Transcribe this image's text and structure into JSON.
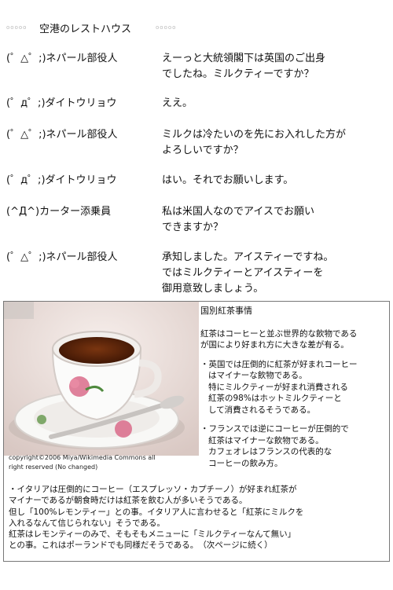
{
  "title": "空港のレストハウス",
  "title_deco": "ooooo",
  "dialogue": [
    {
      "speaker": "(゜△゜;)ネパール部役人",
      "lines": [
        "えーっと大統領閣下は英国のご出身",
        "でしたね。ミルクティーですか？"
      ]
    },
    {
      "speaker": "(゜д゜;)ダイトウリョウ",
      "lines": [
        "ええ。"
      ]
    },
    {
      "speaker": "(゜△゜;)ネパール部役人",
      "lines": [
        "ミルクは冷たいのを先にお入れした方が",
        "よろしいですか？"
      ]
    },
    {
      "speaker": "(゜д゜;)ダイトウリョウ",
      "lines": [
        "はい。それでお願いします。"
      ]
    },
    {
      "speaker": "(^Д^)カーター添乗員",
      "lines": [
        "私は米国人なのでアイスでお願い",
        "できますか？"
      ]
    },
    {
      "speaker": "(゜△゜;)ネパール部役人",
      "lines": [
        "承知しました。アイスティーですね。",
        "ではミルクティーとアイスティーを",
        "御用意致しましょう。"
      ]
    }
  ],
  "photo": {
    "icon": "teacup-photo",
    "credit": "copyright©2006 Miya/Wikimedia Commons all\nright reserved (No changed)"
  },
  "notes": {
    "heading": "国別紅茶事情",
    "intro": "紅茶はコーヒーと並ぶ世界的な飲物である\nが国により好まれ方に大きな差が有る。",
    "bullets": [
      "・英国では圧倒的に紅茶が好まれコーヒー\nはマイナーな飲物である。\n特にミルクティーが好まれ消費される\n紅茶の98%はホットミルクティーと\nして消費されるそうである。",
      "・フランスでは逆にコーヒーが圧倒的で\n紅茶はマイナーな飲物である。\nカフェオレはフランスの代表的な\nコーヒーの飲み方。"
    ],
    "bottom": "・イタリアは圧倒的にコーヒー（エスプレッソ・カプチーノ）が好まれ紅茶が\nマイナーであるが朝食時だけは紅茶を飲む人が多いそうである。\n但し「100%レモンティー」との事。イタリア人に言わせると「紅茶にミルクを\n入れるなんて信じられない」そうである。\n紅茶はレモンティーのみで、そもそもメニューに「ミルクティーなんて無い」\nとの事。これはポーランドでも同様だそうである。　（次ページに続く）"
  },
  "colors": {
    "background": "#ffffff",
    "border": "#777777",
    "tea": "#6b2c0c",
    "rose": "#d96b8a",
    "saucer": "#f7f7f5"
  }
}
